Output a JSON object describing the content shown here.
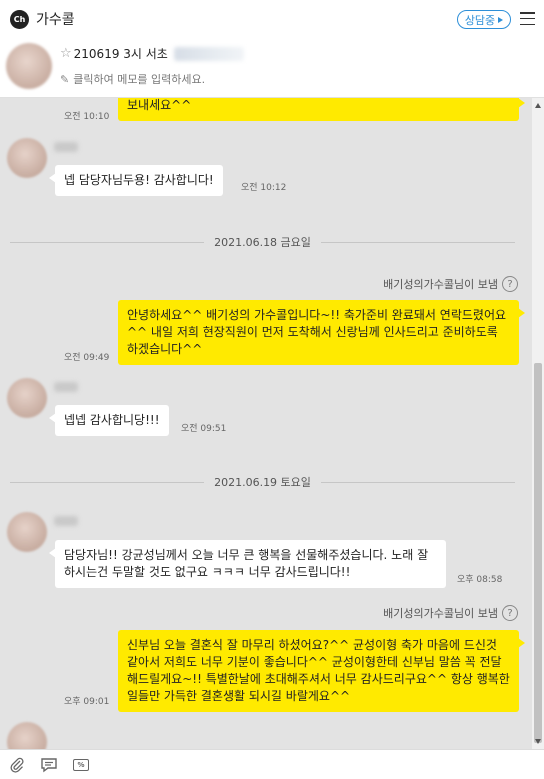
{
  "header": {
    "logo": "Ch",
    "title": "가수콜",
    "status_label": "상담중",
    "menu_icon": "hamburger-icon"
  },
  "profile": {
    "name": "210619 3시 서초",
    "memo_placeholder": "클릭하여 메모를 입력하세요."
  },
  "messages": [
    {
      "type": "out",
      "text": "보내세요^^",
      "time": "오전 10:10"
    },
    {
      "type": "in",
      "text": "넵 담당자님두용! 감사합니다!",
      "time": "오전 10:12"
    },
    {
      "type": "date",
      "label": "2021.06.18 금요일"
    },
    {
      "type": "sent_by",
      "label": "배기성의가수콜님이 보냄"
    },
    {
      "type": "out",
      "text": "안녕하세요^^ 배기성의 가수콜입니다~!! 축가준비 완료돼서 연락드렸어요^^ 내일 저희 현장직원이 먼저 도착해서 신랑님께 인사드리고 준비하도록 하겠습니다^^",
      "time": "오전 09:49"
    },
    {
      "type": "in",
      "text": "넵넵 감사합니당!!!",
      "time": "오전 09:51"
    },
    {
      "type": "date",
      "label": "2021.06.19 토요일"
    },
    {
      "type": "in",
      "text": "담당자님!! 강균성님께서 오늘 너무 큰 행복을 선물해주셨습니다. 노래 잘하시는건 두말할 것도 없구요 ㅋㅋㅋ 너무 감사드립니다!!",
      "time": "오후 08:58"
    },
    {
      "type": "sent_by",
      "label": "배기성의가수콜님이 보냄"
    },
    {
      "type": "out",
      "text": "신부님 오늘 결혼식 잘 마무리 하셨어요?^^ 균성이형 축가 마음에 드신것 같아서 저희도 너무 기분이 좋습니다^^ 균성이형한테 신부님 말씀 꼭 전달해드릴게요~!! 특별한날에 초대해주셔서 너무 감사드리구요^^ 항상 행복한 일들만 가득한 결혼생활 되시길 바랄게요^^",
      "time": "오후 09:01"
    }
  ],
  "footer": {
    "icons": [
      "attach-icon",
      "chat-bubble-icon",
      "percent-icon"
    ]
  },
  "colors": {
    "accent": "#2d8fd8",
    "out_bubble": "#ffea00",
    "chat_bg": "#e3e3e3"
  }
}
